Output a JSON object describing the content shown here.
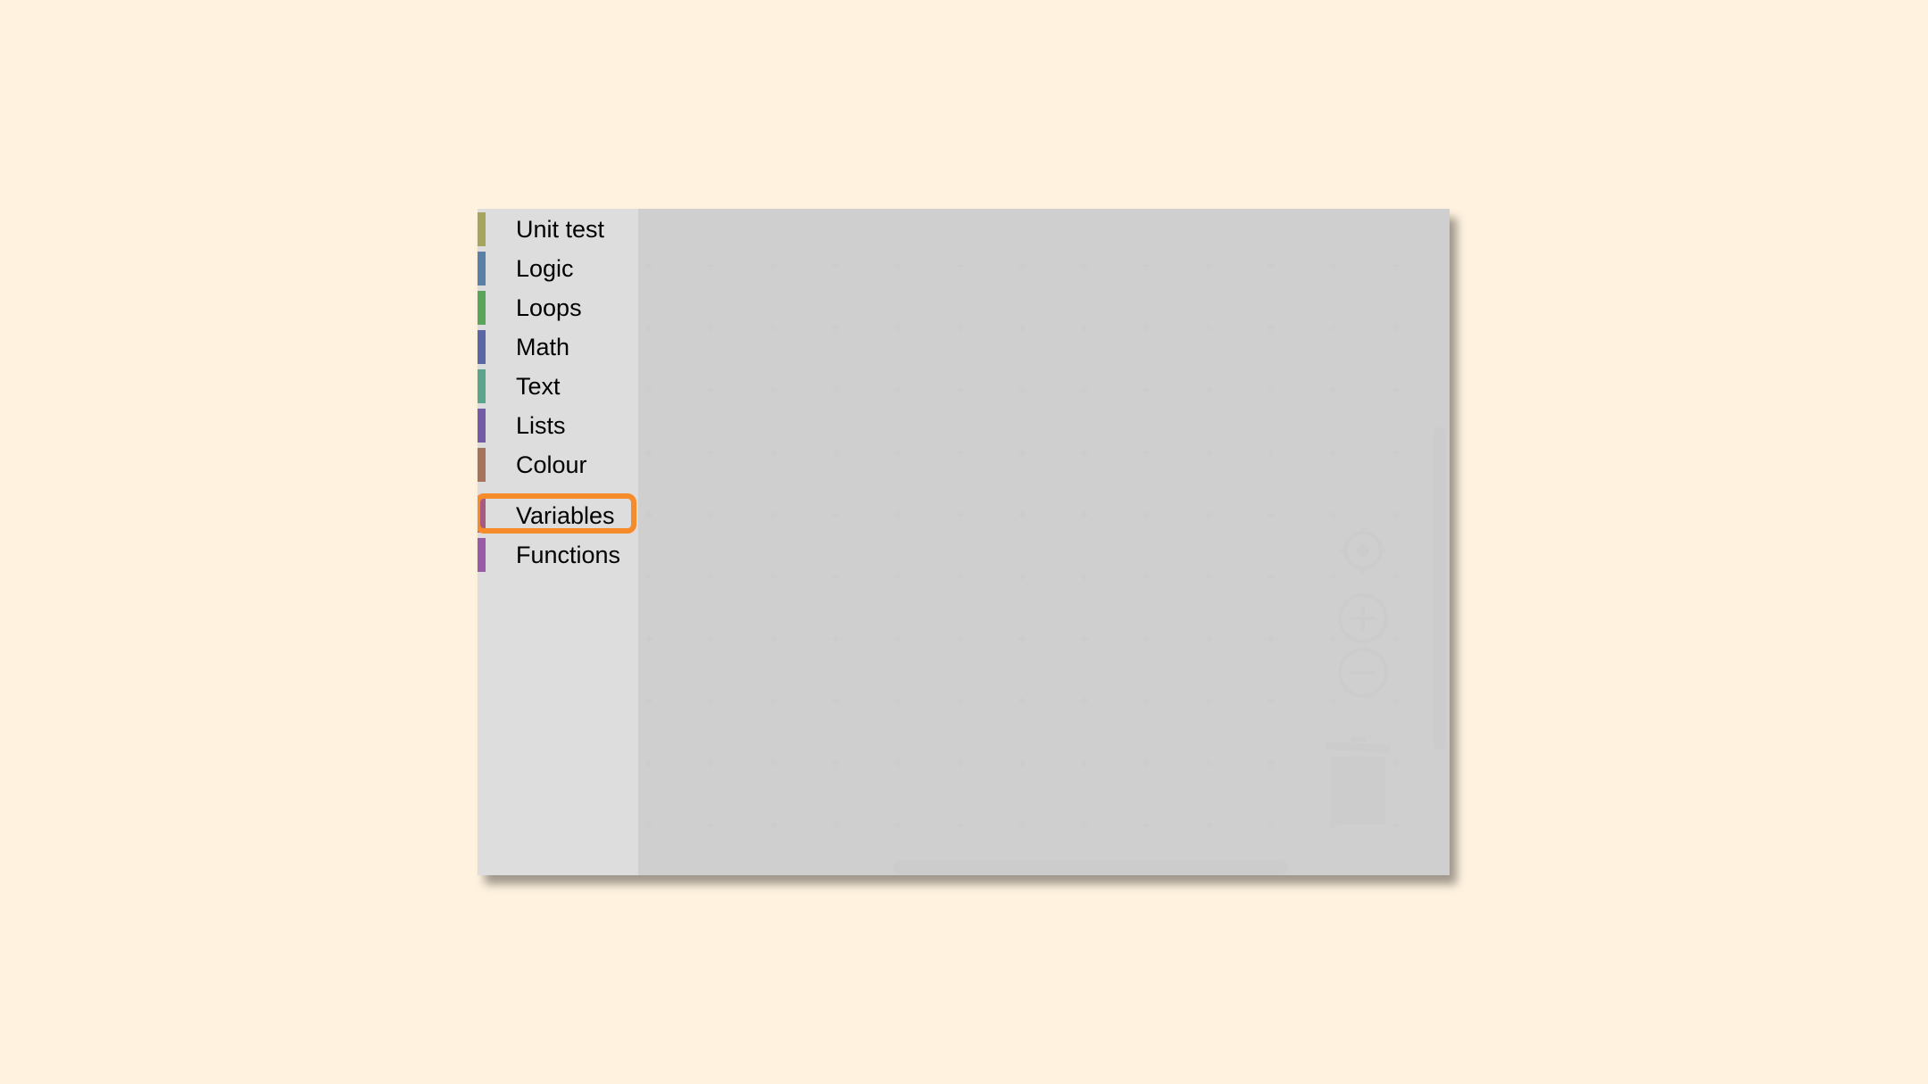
{
  "toolbox": {
    "categories": [
      {
        "label": "Unit test",
        "color": "#a5a55b"
      },
      {
        "label": "Logic",
        "color": "#5b80a5"
      },
      {
        "label": "Loops",
        "color": "#5ba55b"
      },
      {
        "label": "Math",
        "color": "#5b67a5"
      },
      {
        "label": "Text",
        "color": "#5ba58c"
      },
      {
        "label": "Lists",
        "color": "#745ba5"
      },
      {
        "label": "Colour",
        "color": "#a5745b"
      },
      {
        "label": "Variables",
        "color": "#a55b80"
      },
      {
        "label": "Functions",
        "color": "#995ba5"
      }
    ],
    "selected": "Variables",
    "highlight_color": "#f68b2c"
  },
  "workspace": {
    "controls": {
      "recenter_icon": "target-icon",
      "zoom_in_icon": "zoom-in-icon",
      "zoom_out_icon": "zoom-out-icon",
      "trash_icon": "trash-can-icon"
    }
  }
}
